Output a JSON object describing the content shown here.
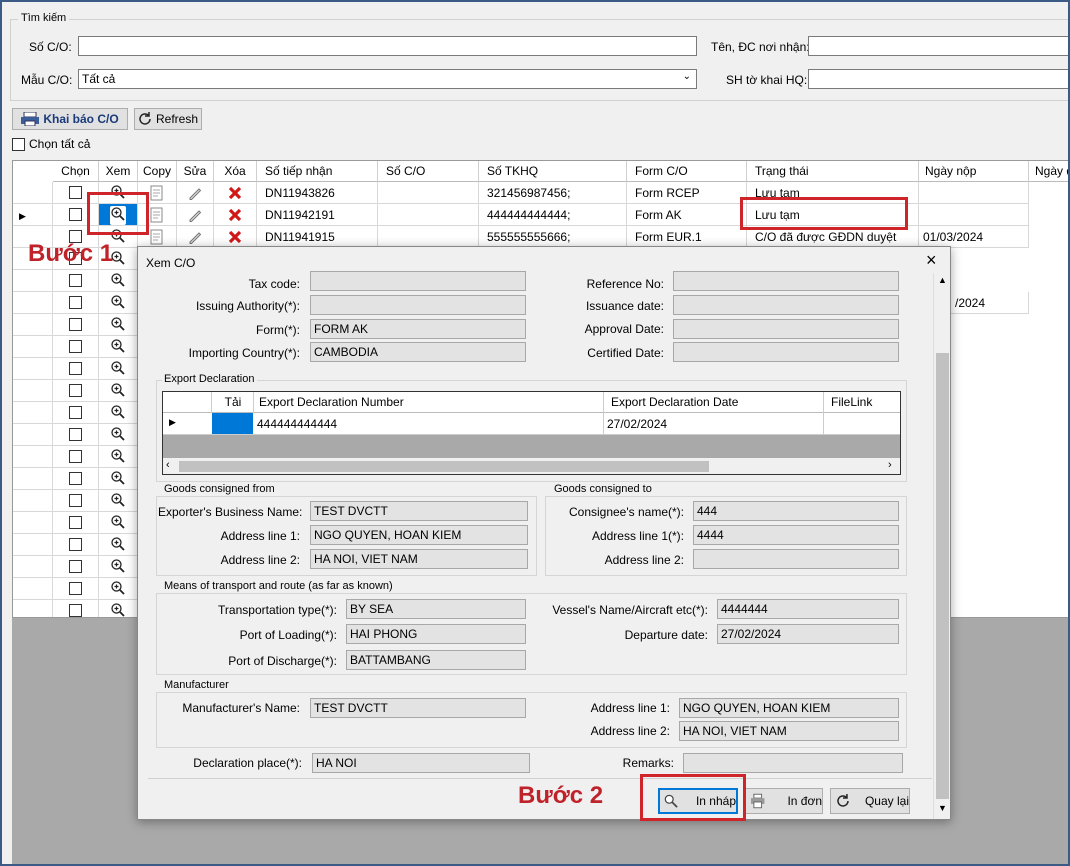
{
  "search": {
    "group_title": "Tìm kiếm",
    "so_co_label": "Số C/O:",
    "so_co_value": "",
    "mau_co_label": "Mẫu C/O:",
    "mau_co_value": "Tất cả",
    "ten_dc_label": "Tên, ĐC nơi nhận:",
    "ten_dc_value": "",
    "sh_tokhai_label": "SH tờ khai HQ:",
    "sh_tokhai_value": ""
  },
  "toolbar": {
    "khai_bao_label": "Khai báo C/O",
    "refresh_label": "Refresh",
    "chon_tat_ca_label": "Chọn tất cả"
  },
  "grid": {
    "headers": [
      "Chọn",
      "Xem",
      "Copy",
      "Sửa",
      "Xóa",
      "Số tiếp nhận",
      "Số C/O",
      "Số TKHQ",
      "Form C/O",
      "Trạng thái",
      "Ngày nộp",
      "Ngày d"
    ],
    "rows": [
      {
        "so_tiep_nhan": "DN11943826",
        "so_co": "",
        "so_tkhq": "321456987456;",
        "form": "Form RCEP",
        "trang_thai": "Lưu tạm",
        "ngay_nop": ""
      },
      {
        "so_tiep_nhan": "DN11942191",
        "so_co": "",
        "so_tkhq": "444444444444;",
        "form": "Form AK",
        "trang_thai": "Lưu tạm",
        "ngay_nop": ""
      },
      {
        "so_tiep_nhan": "DN11941915",
        "so_co": "",
        "so_tkhq": "555555555666;",
        "form": "Form EUR.1",
        "trang_thai": "C/O đã được GĐDN duyệt",
        "ngay_nop": "01/03/2024"
      }
    ],
    "partial_date": "/2024"
  },
  "annotations": {
    "step1": "Bước 1",
    "step2": "Bước 2",
    "accent_color": "#d0242b"
  },
  "dialog": {
    "title": "Xem C/O",
    "tax_code_label": "Tax code:",
    "tax_code": "",
    "issuing_label": "Issuing Authority(*):",
    "issuing": "",
    "form_label": "Form(*):",
    "form": "FORM AK",
    "importing_label": "Importing Country(*):",
    "importing": "CAMBODIA",
    "reference_label": "Reference No:",
    "reference": "",
    "issuance_label": "Issuance date:",
    "issuance": "",
    "approval_label": "Approval Date:",
    "approval": "",
    "certified_label": "Certified Date:",
    "certified": "",
    "export": {
      "group": "Export Declaration",
      "headers": [
        "Tải",
        "Export Declaration Number",
        "Export Declaration Date",
        "FileLink"
      ],
      "number": "444444444444",
      "date": "27/02/2024"
    },
    "from": {
      "group": "Goods consigned from",
      "name_label": "Exporter's Business Name:",
      "name": "TEST DVCTT",
      "addr1_label": "Address line 1:",
      "addr1": "NGO QUYEN, HOAN KIEM",
      "addr2_label": "Address line 2:",
      "addr2": "HA NOI, VIET NAM"
    },
    "to": {
      "group": "Goods consigned to",
      "name_label": "Consignee's name(*):",
      "name": "444",
      "addr1_label": "Address line 1(*):",
      "addr1": "4444",
      "addr2_label": "Address line 2:",
      "addr2": ""
    },
    "transport": {
      "group": "Means of transport and route (as far as known)",
      "type_label": "Transportation type(*):",
      "type": "BY SEA",
      "loading_label": "Port of Loading(*):",
      "loading": "HAI PHONG",
      "discharge_label": "Port of Discharge(*):",
      "discharge": "BATTAMBANG",
      "vessel_label": "Vessel's Name/Aircraft etc(*):",
      "vessel": "4444444",
      "departure_label": "Departure date:",
      "departure": "27/02/2024"
    },
    "manufacturer": {
      "group": "Manufacturer",
      "name_label": "Manufacturer's Name:",
      "name": "TEST DVCTT",
      "addr1_label": "Address line 1:",
      "addr1": "NGO QUYEN, HOAN KIEM",
      "addr2_label": "Address line 2:",
      "addr2": "HA NOI, VIET NAM"
    },
    "place_label": "Declaration place(*):",
    "place": "HA NOI",
    "remarks_label": "Remarks:",
    "remarks": "",
    "buttons": {
      "in_nhap": "In nháp",
      "in_don": "In đơn",
      "quay_lai": "Quay lại"
    }
  }
}
